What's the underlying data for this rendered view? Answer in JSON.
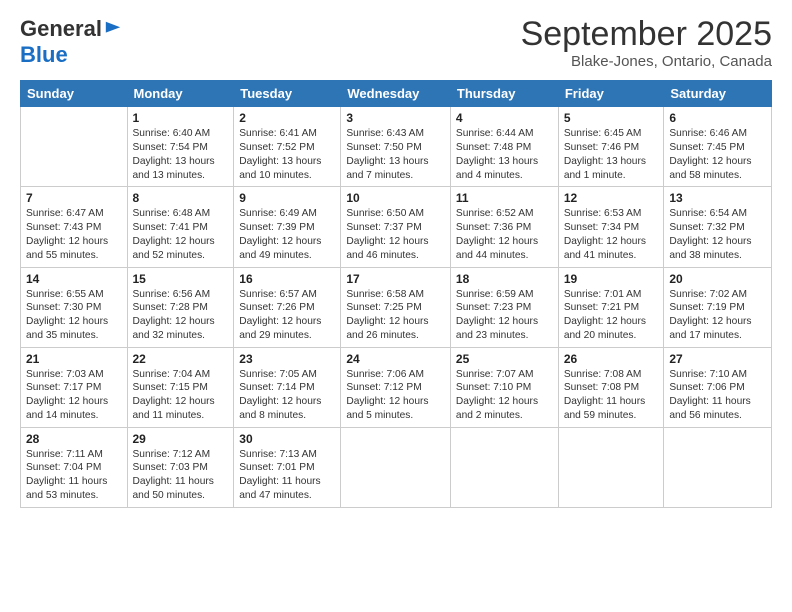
{
  "logo": {
    "general": "General",
    "blue": "Blue"
  },
  "title": "September 2025",
  "location": "Blake-Jones, Ontario, Canada",
  "days_of_week": [
    "Sunday",
    "Monday",
    "Tuesday",
    "Wednesday",
    "Thursday",
    "Friday",
    "Saturday"
  ],
  "weeks": [
    [
      {
        "day": "",
        "sunrise": "",
        "sunset": "",
        "daylight": ""
      },
      {
        "day": "1",
        "sunrise": "Sunrise: 6:40 AM",
        "sunset": "Sunset: 7:54 PM",
        "daylight": "Daylight: 13 hours and 13 minutes."
      },
      {
        "day": "2",
        "sunrise": "Sunrise: 6:41 AM",
        "sunset": "Sunset: 7:52 PM",
        "daylight": "Daylight: 13 hours and 10 minutes."
      },
      {
        "day": "3",
        "sunrise": "Sunrise: 6:43 AM",
        "sunset": "Sunset: 7:50 PM",
        "daylight": "Daylight: 13 hours and 7 minutes."
      },
      {
        "day": "4",
        "sunrise": "Sunrise: 6:44 AM",
        "sunset": "Sunset: 7:48 PM",
        "daylight": "Daylight: 13 hours and 4 minutes."
      },
      {
        "day": "5",
        "sunrise": "Sunrise: 6:45 AM",
        "sunset": "Sunset: 7:46 PM",
        "daylight": "Daylight: 13 hours and 1 minute."
      },
      {
        "day": "6",
        "sunrise": "Sunrise: 6:46 AM",
        "sunset": "Sunset: 7:45 PM",
        "daylight": "Daylight: 12 hours and 58 minutes."
      }
    ],
    [
      {
        "day": "7",
        "sunrise": "Sunrise: 6:47 AM",
        "sunset": "Sunset: 7:43 PM",
        "daylight": "Daylight: 12 hours and 55 minutes."
      },
      {
        "day": "8",
        "sunrise": "Sunrise: 6:48 AM",
        "sunset": "Sunset: 7:41 PM",
        "daylight": "Daylight: 12 hours and 52 minutes."
      },
      {
        "day": "9",
        "sunrise": "Sunrise: 6:49 AM",
        "sunset": "Sunset: 7:39 PM",
        "daylight": "Daylight: 12 hours and 49 minutes."
      },
      {
        "day": "10",
        "sunrise": "Sunrise: 6:50 AM",
        "sunset": "Sunset: 7:37 PM",
        "daylight": "Daylight: 12 hours and 46 minutes."
      },
      {
        "day": "11",
        "sunrise": "Sunrise: 6:52 AM",
        "sunset": "Sunset: 7:36 PM",
        "daylight": "Daylight: 12 hours and 44 minutes."
      },
      {
        "day": "12",
        "sunrise": "Sunrise: 6:53 AM",
        "sunset": "Sunset: 7:34 PM",
        "daylight": "Daylight: 12 hours and 41 minutes."
      },
      {
        "day": "13",
        "sunrise": "Sunrise: 6:54 AM",
        "sunset": "Sunset: 7:32 PM",
        "daylight": "Daylight: 12 hours and 38 minutes."
      }
    ],
    [
      {
        "day": "14",
        "sunrise": "Sunrise: 6:55 AM",
        "sunset": "Sunset: 7:30 PM",
        "daylight": "Daylight: 12 hours and 35 minutes."
      },
      {
        "day": "15",
        "sunrise": "Sunrise: 6:56 AM",
        "sunset": "Sunset: 7:28 PM",
        "daylight": "Daylight: 12 hours and 32 minutes."
      },
      {
        "day": "16",
        "sunrise": "Sunrise: 6:57 AM",
        "sunset": "Sunset: 7:26 PM",
        "daylight": "Daylight: 12 hours and 29 minutes."
      },
      {
        "day": "17",
        "sunrise": "Sunrise: 6:58 AM",
        "sunset": "Sunset: 7:25 PM",
        "daylight": "Daylight: 12 hours and 26 minutes."
      },
      {
        "day": "18",
        "sunrise": "Sunrise: 6:59 AM",
        "sunset": "Sunset: 7:23 PM",
        "daylight": "Daylight: 12 hours and 23 minutes."
      },
      {
        "day": "19",
        "sunrise": "Sunrise: 7:01 AM",
        "sunset": "Sunset: 7:21 PM",
        "daylight": "Daylight: 12 hours and 20 minutes."
      },
      {
        "day": "20",
        "sunrise": "Sunrise: 7:02 AM",
        "sunset": "Sunset: 7:19 PM",
        "daylight": "Daylight: 12 hours and 17 minutes."
      }
    ],
    [
      {
        "day": "21",
        "sunrise": "Sunrise: 7:03 AM",
        "sunset": "Sunset: 7:17 PM",
        "daylight": "Daylight: 12 hours and 14 minutes."
      },
      {
        "day": "22",
        "sunrise": "Sunrise: 7:04 AM",
        "sunset": "Sunset: 7:15 PM",
        "daylight": "Daylight: 12 hours and 11 minutes."
      },
      {
        "day": "23",
        "sunrise": "Sunrise: 7:05 AM",
        "sunset": "Sunset: 7:14 PM",
        "daylight": "Daylight: 12 hours and 8 minutes."
      },
      {
        "day": "24",
        "sunrise": "Sunrise: 7:06 AM",
        "sunset": "Sunset: 7:12 PM",
        "daylight": "Daylight: 12 hours and 5 minutes."
      },
      {
        "day": "25",
        "sunrise": "Sunrise: 7:07 AM",
        "sunset": "Sunset: 7:10 PM",
        "daylight": "Daylight: 12 hours and 2 minutes."
      },
      {
        "day": "26",
        "sunrise": "Sunrise: 7:08 AM",
        "sunset": "Sunset: 7:08 PM",
        "daylight": "Daylight: 11 hours and 59 minutes."
      },
      {
        "day": "27",
        "sunrise": "Sunrise: 7:10 AM",
        "sunset": "Sunset: 7:06 PM",
        "daylight": "Daylight: 11 hours and 56 minutes."
      }
    ],
    [
      {
        "day": "28",
        "sunrise": "Sunrise: 7:11 AM",
        "sunset": "Sunset: 7:04 PM",
        "daylight": "Daylight: 11 hours and 53 minutes."
      },
      {
        "day": "29",
        "sunrise": "Sunrise: 7:12 AM",
        "sunset": "Sunset: 7:03 PM",
        "daylight": "Daylight: 11 hours and 50 minutes."
      },
      {
        "day": "30",
        "sunrise": "Sunrise: 7:13 AM",
        "sunset": "Sunset: 7:01 PM",
        "daylight": "Daylight: 11 hours and 47 minutes."
      },
      {
        "day": "",
        "sunrise": "",
        "sunset": "",
        "daylight": ""
      },
      {
        "day": "",
        "sunrise": "",
        "sunset": "",
        "daylight": ""
      },
      {
        "day": "",
        "sunrise": "",
        "sunset": "",
        "daylight": ""
      },
      {
        "day": "",
        "sunrise": "",
        "sunset": "",
        "daylight": ""
      }
    ]
  ]
}
